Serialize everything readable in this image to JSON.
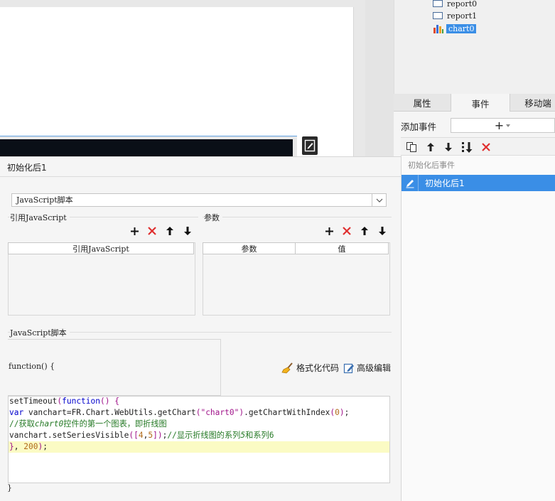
{
  "tree": {
    "items": [
      {
        "label": "report0"
      },
      {
        "label": "report1"
      },
      {
        "label": "chart0"
      }
    ]
  },
  "right_tabs": [
    "属性",
    "事件",
    "移动端"
  ],
  "event_panel": {
    "add_event_label": "添加事件",
    "add_event_symbol": "+",
    "group_label": "初始化后事件",
    "selected_event": "初始化后1"
  },
  "editor": {
    "title": "初始化后1",
    "type_select_value": "JavaScript脚本",
    "ref_js_section": "引用JavaScript",
    "ref_js_column": "引用JavaScript",
    "params_section": "参数",
    "params_columns": [
      "参数",
      "值"
    ],
    "js_section": "JavaScript脚本",
    "function_header": "function() {",
    "format_button": "格式化代码",
    "advanced_button": "高级编辑",
    "code_lines": [
      "setTimeout(function() {",
      "var vanchart=FR.Chart.WebUtils.getChart(\"chart0\").getChartWithIndex(0);",
      "//获取chart0控件的第一个图表，即折线图",
      "vanchart.setSeriesVisible([4,5]);//显示折线图的系列5和系列6",
      "}, 200);"
    ],
    "closing_brace": "}"
  },
  "colors": {
    "selection": "#3a8ee6",
    "delete_red": "#e03030",
    "code_keyword": "#0000cc",
    "code_string": "#a0148a",
    "code_comment": "#267a26",
    "line_highlight": "#fbfbc4"
  }
}
